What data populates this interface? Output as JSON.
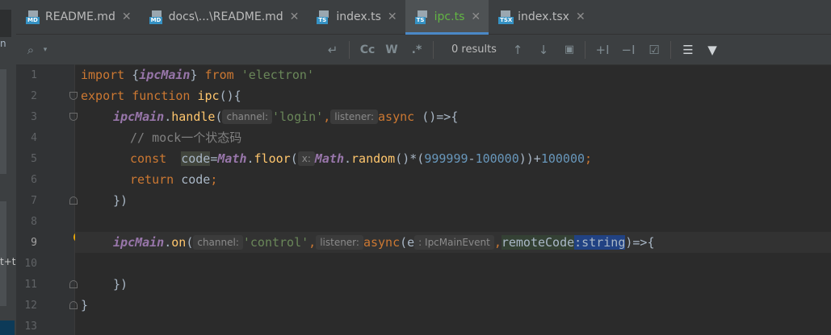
{
  "left_panel": {
    "line_a": "n",
    "line_b": "t+t"
  },
  "tabs": [
    {
      "label": "README.md",
      "type": "md",
      "active": false
    },
    {
      "label": "docs\\...\\README.md",
      "type": "md",
      "active": false
    },
    {
      "label": "index.ts",
      "type": "ts",
      "active": false
    },
    {
      "label": "ipc.ts",
      "type": "ts",
      "active": true
    },
    {
      "label": "index.tsx",
      "type": "tsx",
      "active": false
    }
  ],
  "icon_badges": {
    "md": "MD",
    "ts": "TS",
    "tsx": "TSX"
  },
  "find": {
    "results": "0 results",
    "match_case": "Cc",
    "words": "W",
    "regex": ".*"
  },
  "line_numbers": [
    "1",
    "2",
    "3",
    "4",
    "5",
    "6",
    "7",
    "8",
    "9",
    "10",
    "11",
    "12",
    "13"
  ],
  "code": {
    "l1": {
      "import": "import ",
      "brace_open": "{",
      "ipcMain": "ipcMain",
      "brace_close": "} ",
      "from": "from ",
      "module": "'electron'"
    },
    "l2": {
      "export": "export ",
      "function": "function ",
      "name": "ipc",
      "rest": "(){"
    },
    "l3": {
      "ipcMain": "ipcMain",
      "dot": ".",
      "method": "handle",
      "paren": "(",
      "hint_channel": "channel:",
      "channel": "'login'",
      "comma": ",",
      "hint_listener": "listener:",
      "async": "async ",
      "arrow": "()=>{"
    },
    "l4": {
      "comment": "// mock一个状态码"
    },
    "l5": {
      "const": "const  ",
      "var": "code",
      "eq": "=",
      "math": "Math",
      "dot": ".",
      "floor": "floor",
      "paren": "(",
      "hint_x": "x:",
      "math2": "Math",
      "dot2": ".",
      "random": "random",
      "mid": "()*(",
      "n1": "999999",
      "minus": "-",
      "n2": "100000",
      "close": "))+",
      "n3": "100000",
      "semi": ";"
    },
    "l6": {
      "return": "return ",
      "var": "code",
      "semi": ";"
    },
    "l7": {
      "close": "})"
    },
    "l9": {
      "ipcMain": "ipcMain",
      "dot": ".",
      "method": "on",
      "paren": "(",
      "hint_channel": "channel:",
      "channel": "'control'",
      "comma": ",",
      "hint_listener": "listener:",
      "async": "async",
      "paren2": "(",
      "param_e": "e",
      "hint_type": ": IpcMainEvent",
      "comma2": ",",
      "param2": "remoteCode",
      "type": ":string",
      "rest": ")=>{"
    },
    "l11": {
      "close": "})"
    },
    "l12": {
      "close": "}"
    }
  }
}
